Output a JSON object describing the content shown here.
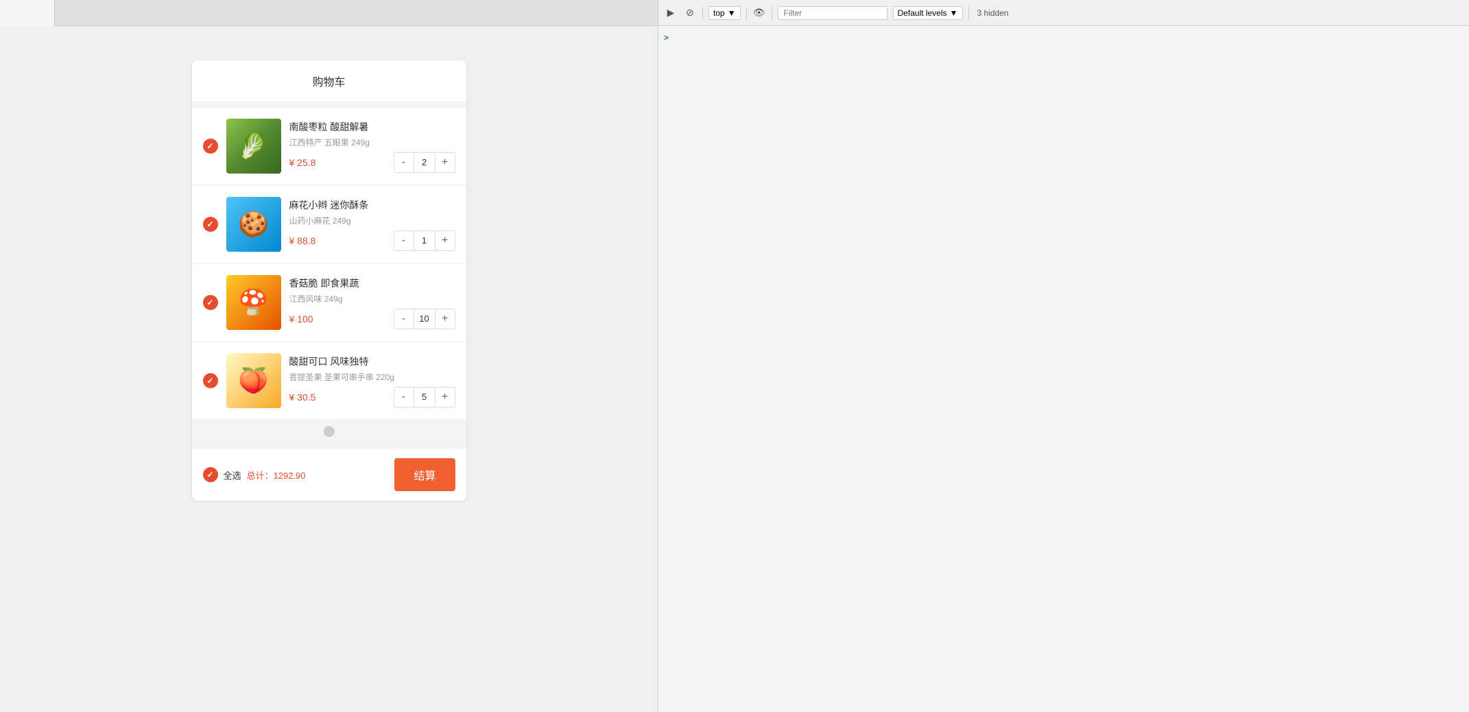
{
  "leftPanel": {
    "tabs": [
      {
        "label": ""
      }
    ]
  },
  "cart": {
    "title": "购物车",
    "items": [
      {
        "id": "item-1",
        "name": "南酸枣粒 酸甜解暑",
        "desc": "江西特产 五眼果 249g",
        "price": "¥ 25.8",
        "quantity": 2,
        "checked": true,
        "imageClass": "img-1"
      },
      {
        "id": "item-2",
        "name": "麻花小辫 迷你酥条",
        "desc": "山药小麻花 249g",
        "price": "¥ 88.8",
        "quantity": 1,
        "checked": true,
        "imageClass": "img-2"
      },
      {
        "id": "item-3",
        "name": "香菇脆 即食果蔬",
        "desc": "江西风味 249g",
        "price": "¥ 100",
        "quantity": 10,
        "checked": true,
        "imageClass": "img-3"
      },
      {
        "id": "item-4",
        "name": "酸甜可口 风味独特",
        "desc": "菩提圣果 圣果可串手串 220g",
        "price": "¥ 30.5",
        "quantity": 5,
        "checked": true,
        "imageClass": "img-4"
      }
    ],
    "footer": {
      "selectAllLabel": "全选",
      "totalLabel": "总计：1292.90",
      "checkoutLabel": "结算"
    }
  },
  "devtools": {
    "toolbar": {
      "contextLabel": "top",
      "filterPlaceholder": "Filter",
      "levelsLabel": "Default levels",
      "hiddenText": "3 hidden"
    },
    "icons": {
      "play": "▶",
      "stop": "⊘",
      "eye": "👁",
      "dropdown": "▼"
    },
    "console": {
      "arrow": ">"
    }
  }
}
